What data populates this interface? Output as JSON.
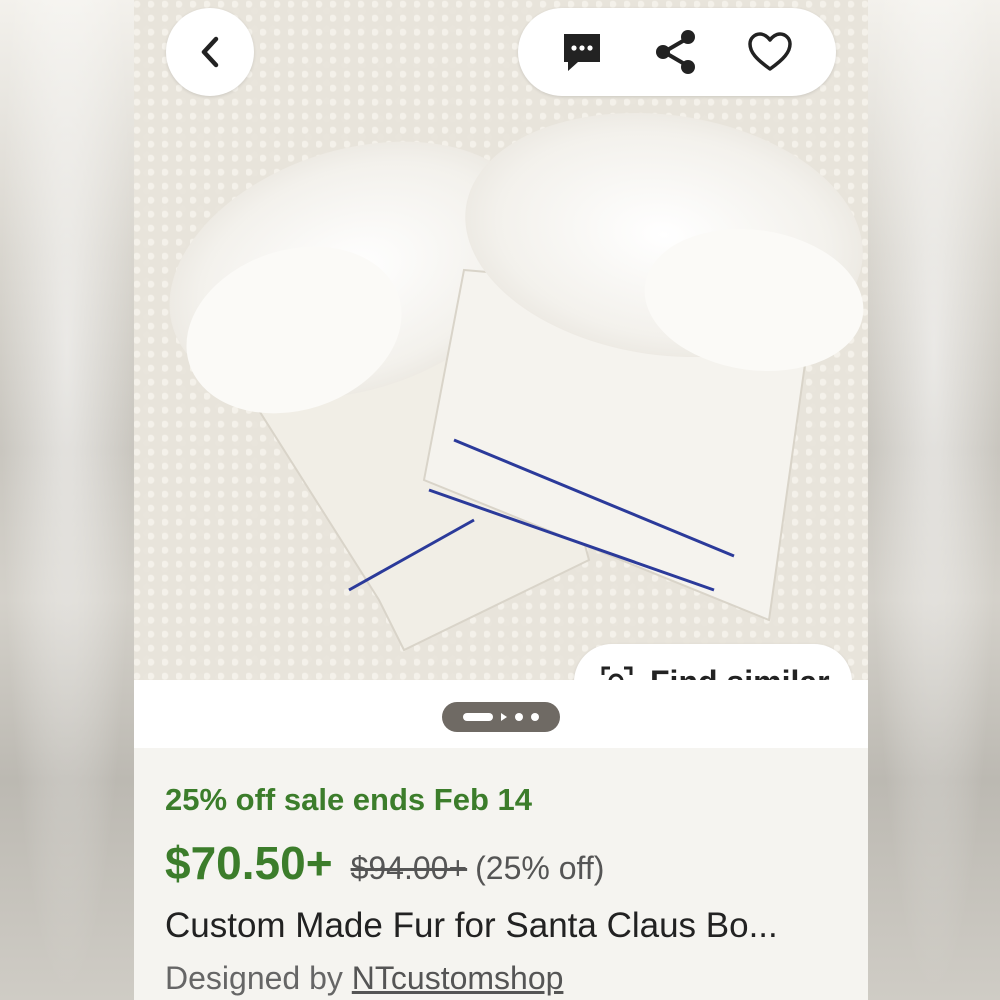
{
  "header": {
    "back_icon": "chevron-left-icon",
    "actions": [
      "message-icon",
      "share-icon",
      "heart-icon"
    ]
  },
  "image": {
    "find_similar_label": "Find similar",
    "pager_total": 4,
    "pager_current": 1
  },
  "listing": {
    "sale_text": "25% off sale ends Feb 14",
    "price": "$70.50+",
    "original_price": "$94.00+",
    "discount": "(25% off)",
    "title": "Custom Made Fur for Santa Claus Bo...",
    "designed_by_label": "Designed by",
    "shop_name": "NTcustomshop"
  },
  "colors": {
    "sale_green": "#3c7d2b",
    "background": "#f5f4f0",
    "pager_bg": "#6f6a64"
  }
}
